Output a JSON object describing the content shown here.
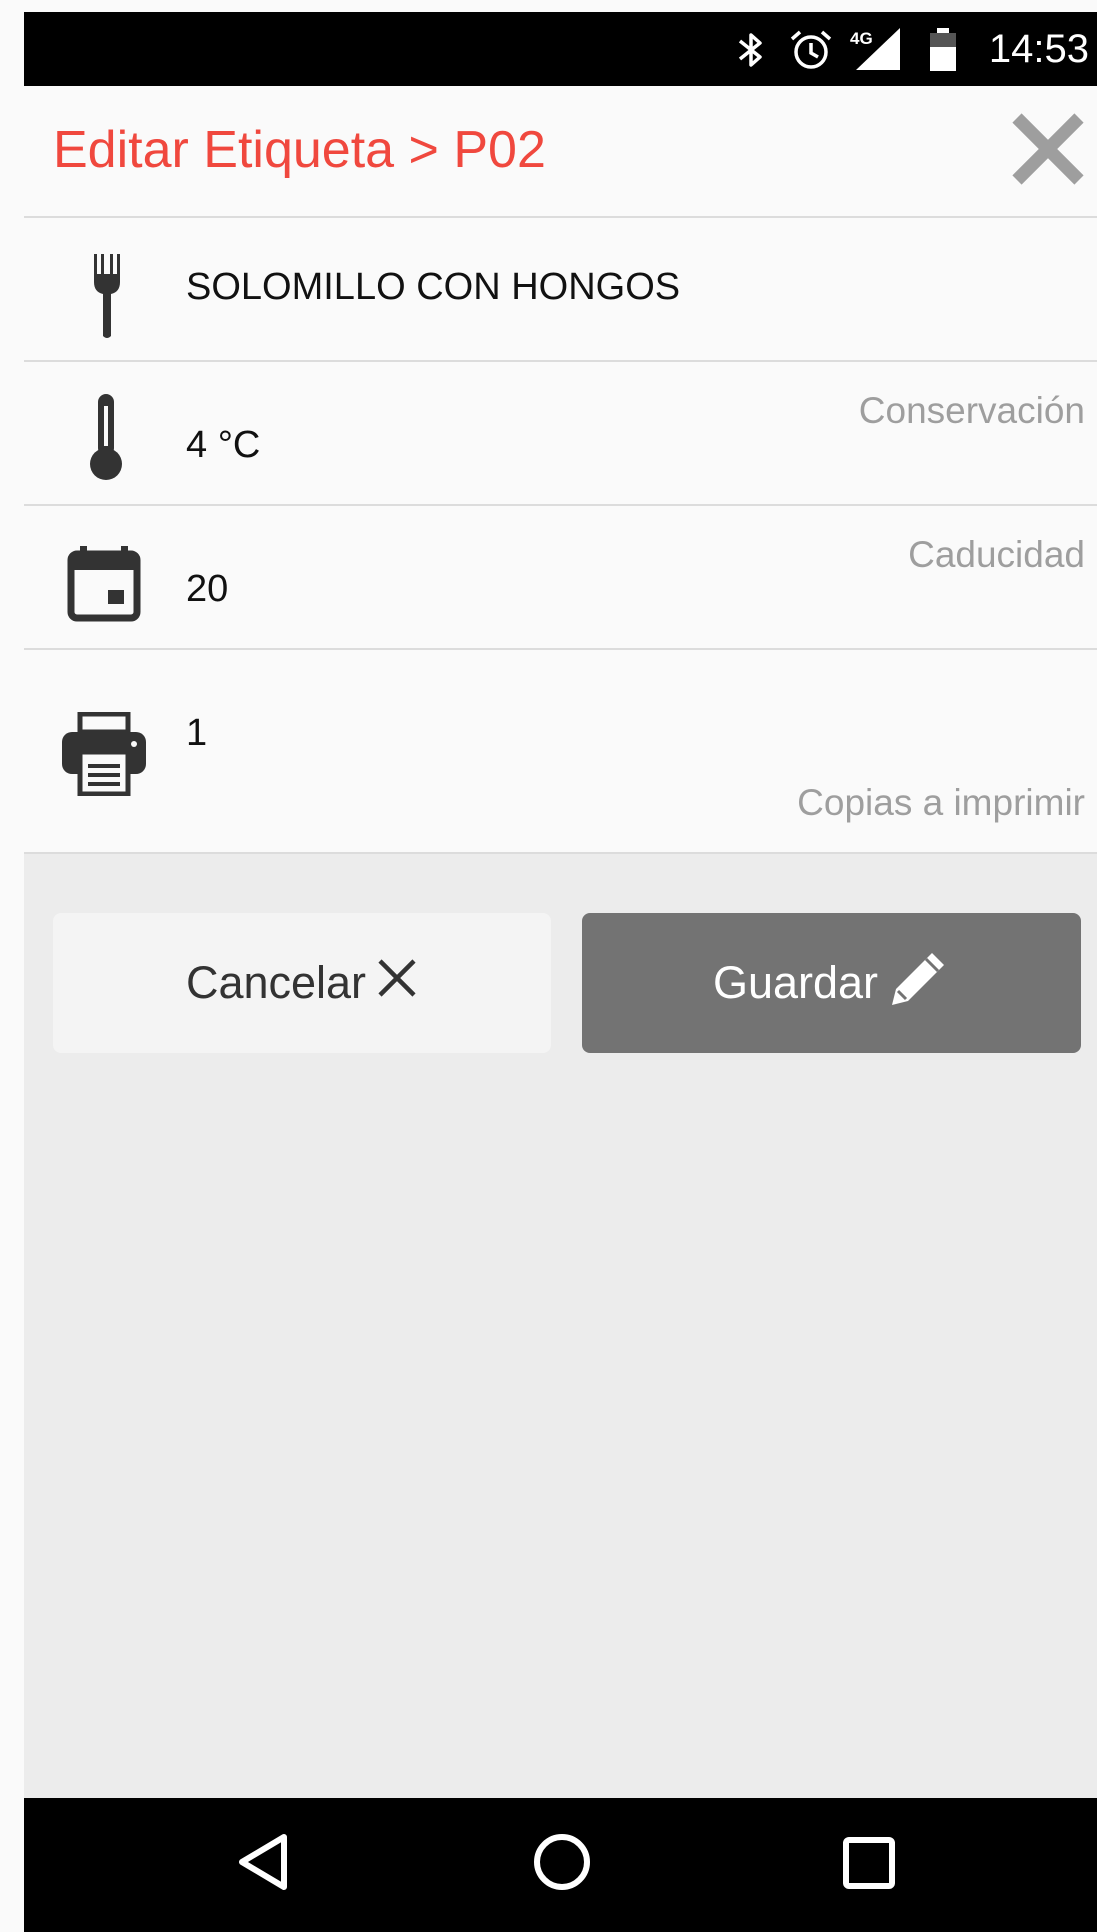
{
  "status_bar": {
    "time": "14:53",
    "network": "4G",
    "icons": [
      "bluetooth-icon",
      "alarm-icon",
      "signal-icon",
      "battery-icon"
    ]
  },
  "header": {
    "title": "Editar Etiqueta > P02",
    "title_color": "#f0483e",
    "close_icon": "close-icon"
  },
  "form": {
    "product": {
      "icon": "fork-icon",
      "value": "SOLOMILLO CON HONGOS"
    },
    "conservation": {
      "icon": "thermometer-icon",
      "value": "4 °C",
      "label": "Conservación"
    },
    "expiry": {
      "icon": "calendar-icon",
      "value": "20",
      "label": "Caducidad"
    },
    "copies": {
      "icon": "printer-icon",
      "value": "1",
      "label": "Copias a imprimir"
    }
  },
  "actions": {
    "cancel_label": "Cancelar",
    "save_label": "Guardar",
    "save_color": "#737373"
  },
  "nav_bar": {
    "icons": [
      "back-icon",
      "home-icon",
      "recents-icon"
    ]
  }
}
